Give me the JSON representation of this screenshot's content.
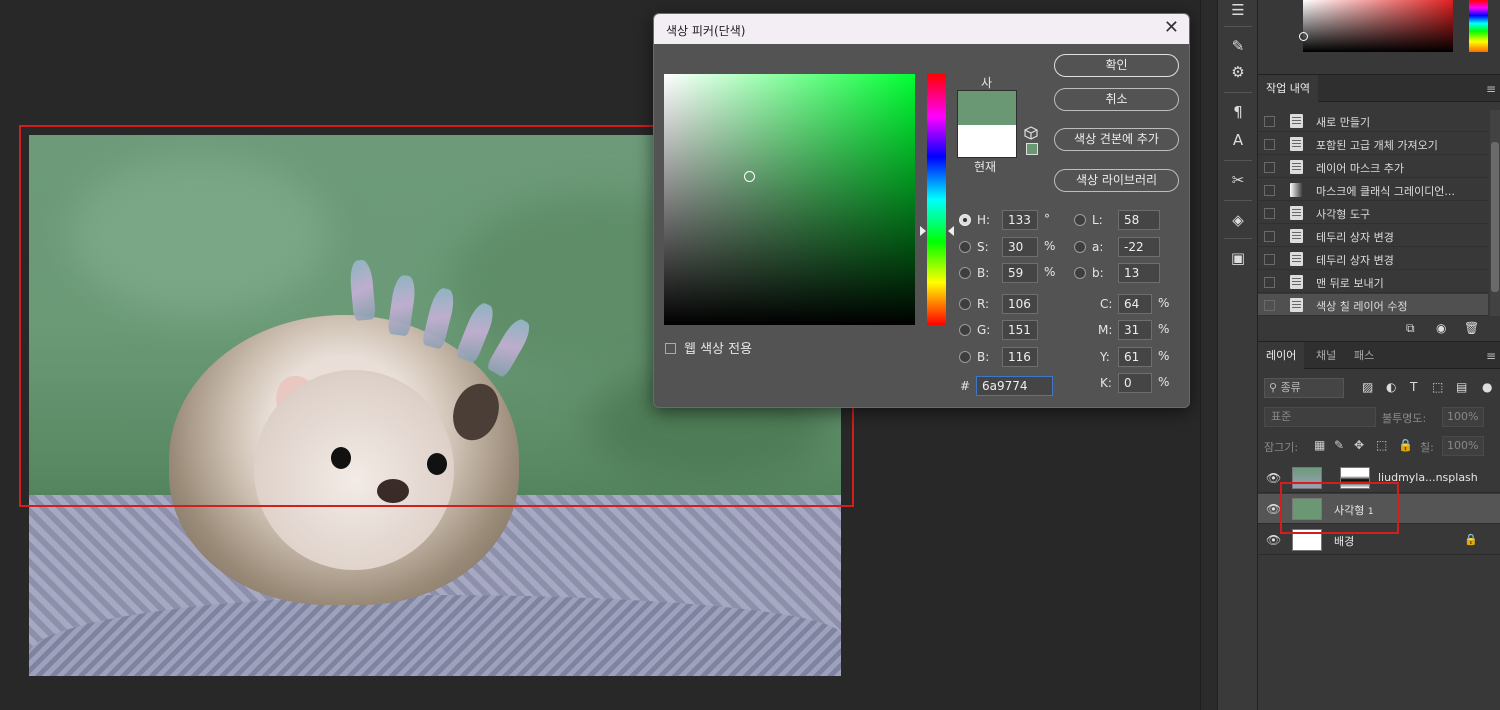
{
  "dialog": {
    "title": "색상 피커(단색)",
    "new_label": "사",
    "current_label": "현재",
    "new_color": "#6a9774",
    "current_color": "#ffffff",
    "buttons": {
      "ok": "확인",
      "cancel": "취소",
      "add_swatch": "색상 견본에 추가",
      "library": "색상 라이브러리"
    },
    "web_only_label": "웹 색상 전용",
    "fields": {
      "H": {
        "label": "H:",
        "value": "133",
        "unit": "°"
      },
      "S": {
        "label": "S:",
        "value": "30",
        "unit": "%"
      },
      "Bv": {
        "label": "B:",
        "value": "59",
        "unit": "%"
      },
      "R": {
        "label": "R:",
        "value": "106"
      },
      "G": {
        "label": "G:",
        "value": "151"
      },
      "Bc": {
        "label": "B:",
        "value": "116"
      },
      "L": {
        "label": "L:",
        "value": "58"
      },
      "a": {
        "label": "a:",
        "value": "-22"
      },
      "b": {
        "label": "b:",
        "value": "13"
      },
      "C": {
        "label": "C:",
        "value": "64",
        "unit": "%"
      },
      "M": {
        "label": "M:",
        "value": "31",
        "unit": "%"
      },
      "Y": {
        "label": "Y:",
        "value": "61",
        "unit": "%"
      },
      "K": {
        "label": "K:",
        "value": "0",
        "unit": "%"
      },
      "hex": {
        "label": "#",
        "value": "6a9774"
      }
    }
  },
  "history": {
    "tab": "작업 내역",
    "items": [
      "새로 만들기",
      "포함된 고급 개체 가져오기",
      "레이어 마스크 추가",
      "마스크에 클래식 그레이디언...",
      "사각형 도구",
      "테두리 상자 변경",
      "테두리 상자 변경",
      "맨 뒤로 보내기",
      "색상 칠 레이어 수정"
    ]
  },
  "layers": {
    "tabs": [
      "레이어",
      "채널",
      "패스"
    ],
    "search_placeholder": "종류",
    "blend_mode": "표준",
    "opacity_label": "불투명도:",
    "opacity_value": "100%",
    "lock_label": "잠그기:",
    "fill_label": "칠:",
    "fill_value": "100%",
    "items": [
      {
        "name": "liudmyla...nsplash"
      },
      {
        "name": "사각형",
        "badge": "1"
      },
      {
        "name": "배경"
      }
    ]
  },
  "colors": {
    "selection": "#d41e1e",
    "accent": "#3c78c8"
  }
}
